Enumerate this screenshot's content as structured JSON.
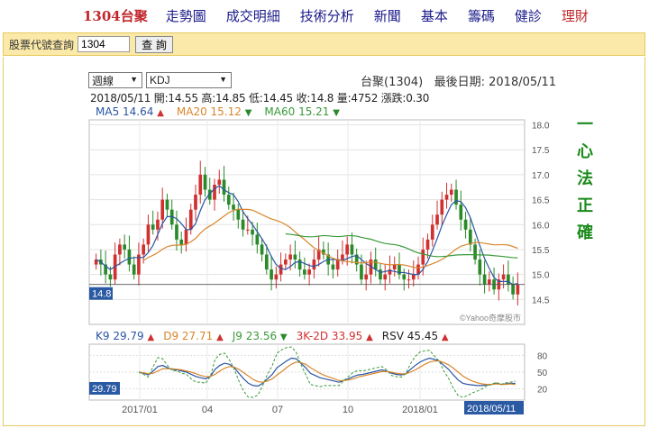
{
  "nav": {
    "items": [
      "1304台聚",
      "走勢圖",
      "成交明細",
      "技術分析",
      "新聞",
      "基本",
      "籌碼",
      "健診",
      "理財"
    ]
  },
  "search": {
    "label": "股票代號查詢",
    "value": "1304",
    "button": "查 詢"
  },
  "controls": {
    "period": "週線",
    "indicator": "KDJ"
  },
  "stock": {
    "header": "台聚(1304)   最後日期: 2018/05/11"
  },
  "quote": {
    "text": "2018/05/11 開:14.55 高:14.85 低:14.45 收:14.8 量:4752 漲跌:0.30"
  },
  "ma": [
    {
      "label": "MA5 14.64",
      "arrow": "▲",
      "color": "#2a55a3",
      "arrow_color": "#d03030"
    },
    {
      "label": "MA20 15.12",
      "arrow": "▼",
      "color": "#d9862c",
      "arrow_color": "#2a8a2a"
    },
    {
      "label": "MA60 15.21",
      "arrow": "▼",
      "color": "#3a9a3a",
      "arrow_color": "#2a8a2a"
    }
  ],
  "indicators": [
    {
      "label": "K9 29.79",
      "arrow": "▲",
      "color": "#2a55a3",
      "arrow_color": "#d03030"
    },
    {
      "label": "D9 27.71",
      "arrow": "▲",
      "color": "#d9862c",
      "arrow_color": "#d03030"
    },
    {
      "label": "J9 23.56",
      "arrow": "▼",
      "color": "#3a9a3a",
      "arrow_color": "#2a8a2a"
    },
    {
      "label": "3K-2D 33.95",
      "arrow": "▲",
      "color": "#d03030",
      "arrow_color": "#d03030"
    },
    {
      "label": "RSV 45.45",
      "arrow": "▲",
      "color": "#222222",
      "arrow_color": "#d03030"
    }
  ],
  "slogan": [
    "一",
    "心",
    "法",
    "正",
    "確"
  ],
  "watermark": "©Yahoo奇摩股市",
  "price_axis": {
    "ticks": [
      "18.0",
      "17.5",
      "17.0",
      "16.5",
      "16.0",
      "15.5",
      "15.0",
      "14.5"
    ],
    "min": 14.0,
    "max": 18.1,
    "last": "14.8"
  },
  "kd_axis": {
    "ticks": [
      "80",
      "50",
      "20"
    ],
    "last": "29.79"
  },
  "date_axis": {
    "ticks": [
      "2017/01",
      "04",
      "07",
      "10",
      "2018/01"
    ],
    "last": "2018/05/11"
  },
  "colors": {
    "up": "#d03030",
    "down": "#2a8a2a",
    "ma5": "#2a55a3",
    "ma20": "#d9862c",
    "ma60": "#3a9a3a",
    "badge": "#2a5aa3"
  },
  "chart_data": {
    "type": "candlestick",
    "y_range": [
      14.0,
      18.1
    ],
    "closes": [
      15.3,
      15.2,
      15.0,
      14.9,
      15.4,
      15.6,
      15.5,
      15.2,
      15.0,
      15.4,
      15.6,
      16.0,
      15.9,
      16.1,
      16.5,
      16.3,
      16.0,
      15.7,
      15.6,
      15.9,
      16.3,
      16.6,
      17.0,
      16.7,
      16.5,
      16.8,
      16.9,
      16.6,
      16.4,
      16.3,
      16.1,
      15.9,
      15.9,
      15.8,
      15.6,
      15.4,
      15.1,
      14.9,
      15.0,
      15.2,
      15.3,
      15.4,
      15.3,
      15.1,
      15.0,
      15.1,
      15.3,
      15.5,
      15.4,
      15.2,
      15.1,
      15.3,
      15.4,
      15.6,
      15.4,
      15.2,
      14.9,
      15.0,
      15.3,
      15.1,
      14.9,
      15.0,
      15.1,
      15.2,
      15.0,
      14.9,
      14.9,
      15.0,
      15.2,
      15.5,
      15.7,
      16.0,
      16.2,
      16.5,
      16.6,
      16.7,
      16.4,
      16.1,
      15.9,
      15.6,
      15.3,
      15.0,
      14.8,
      14.9,
      14.7,
      14.9,
      15.0,
      14.8,
      14.6,
      14.8
    ],
    "kd_k": [
      50,
      48,
      45,
      52,
      60,
      62,
      58,
      55,
      54,
      52,
      50,
      46,
      42,
      40,
      38,
      42,
      55,
      62,
      66,
      64,
      58,
      48,
      38,
      30,
      26,
      25,
      30,
      38,
      46,
      58,
      64,
      70,
      75,
      74,
      66,
      58,
      48,
      44,
      40,
      38,
      36,
      34,
      32,
      35,
      38,
      42,
      45,
      46,
      48,
      50,
      52,
      54,
      52,
      48,
      46,
      45,
      47,
      55,
      62,
      68,
      72,
      75,
      73,
      70,
      62,
      55,
      45,
      36,
      30,
      28,
      27,
      26,
      26,
      27,
      28,
      30,
      28,
      29,
      30,
      29.79
    ],
    "kd_d": [
      50,
      49,
      47,
      48,
      52,
      56,
      56,
      56,
      55,
      54,
      52,
      50,
      47,
      44,
      42,
      42,
      46,
      52,
      57,
      60,
      59,
      55,
      49,
      43,
      37,
      33,
      32,
      34,
      38,
      45,
      51,
      58,
      64,
      68,
      67,
      64,
      58,
      53,
      48,
      44,
      41,
      38,
      35,
      35,
      36,
      38,
      41,
      43,
      45,
      47,
      49,
      51,
      51,
      50,
      48,
      47,
      47,
      50,
      54,
      59,
      64,
      68,
      70,
      70,
      67,
      63,
      57,
      50,
      43,
      38,
      34,
      31,
      29,
      28,
      28,
      29,
      28,
      28,
      29,
      27.71
    ]
  }
}
